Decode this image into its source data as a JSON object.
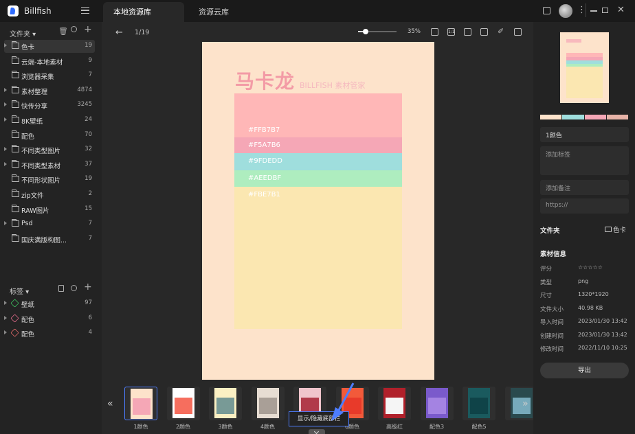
{
  "app": {
    "name": "Billfish"
  },
  "tabs": [
    {
      "label": "本地资源库"
    },
    {
      "label": "资源云库"
    }
  ],
  "sidebar": {
    "folders_title": "文件夹",
    "folders": [
      {
        "label": "色卡",
        "count": "19",
        "selected": true,
        "expandable": true
      },
      {
        "label": "云端-本地素材",
        "count": "9",
        "icon": "cloud-folder-icon"
      },
      {
        "label": "浏览器采集",
        "count": "7",
        "icon": "compass-icon"
      },
      {
        "label": "素材整理",
        "count": "4874",
        "expandable": true
      },
      {
        "label": "快传分享",
        "count": "3245",
        "expandable": true
      },
      {
        "label": "8K壁纸",
        "count": "24",
        "expandable": true
      },
      {
        "label": "配色",
        "count": "70"
      },
      {
        "label": "不同类型图片",
        "count": "32",
        "expandable": true
      },
      {
        "label": "不同类型素材",
        "count": "37",
        "expandable": true
      },
      {
        "label": "不同形状图片",
        "count": "19"
      },
      {
        "label": "zip文件",
        "count": "2"
      },
      {
        "label": "RAW图片",
        "count": "15"
      },
      {
        "label": "Psd",
        "count": "7",
        "expandable": true
      },
      {
        "label": "国庆满版构图...",
        "count": "7"
      }
    ],
    "tags_title": "标签",
    "tags": [
      {
        "label": "壁纸",
        "count": "97",
        "color": "#3fbf5f"
      },
      {
        "label": "配色",
        "count": "6",
        "color": "#e06a8a"
      },
      {
        "label": "配色",
        "count": "4",
        "color": "#e06a6a"
      }
    ]
  },
  "viewer": {
    "page_indicator": "1/19",
    "zoom": "35%",
    "zoom_fraction": 0.2,
    "image": {
      "title": "马卡龙",
      "subtitle": "BILLFISH 素材管家",
      "bands": [
        {
          "label": "#FFB7B7",
          "color": "#ffb7b7"
        },
        {
          "label": "#F5A7B6",
          "color": "#f5a7b6"
        },
        {
          "label": "#9FDEDD",
          "color": "#9fdedd"
        },
        {
          "label": "#AEEDBF",
          "color": "#aeedbf"
        },
        {
          "label": "#FBE7B1",
          "color": "#fbe7b1"
        }
      ]
    },
    "thumbnails": [
      {
        "label": "1颜色",
        "selected": true
      },
      {
        "label": "2颜色"
      },
      {
        "label": "3颜色"
      },
      {
        "label": "4颜色"
      },
      {
        "label": ""
      },
      {
        "label": "6颜色"
      },
      {
        "label": "高级红"
      },
      {
        "label": "配色3"
      },
      {
        "label": "配色5"
      },
      {
        "label": ""
      }
    ],
    "tooltip": "显示/隐藏底部栏"
  },
  "inspector": {
    "palette": [
      "#fde3cb",
      "#9fdedd",
      "#f5a7b6",
      "#e7b3a8"
    ],
    "name_value": "1颜色",
    "tags_placeholder": "添加标签",
    "note_placeholder": "添加备注",
    "url_placeholder": "https://",
    "folder_label": "文件夹",
    "folder_value": "色卡",
    "info_title": "素材信息",
    "rows": [
      {
        "label": "评分",
        "value": "☆☆☆☆☆"
      },
      {
        "label": "类型",
        "value": "png"
      },
      {
        "label": "尺寸",
        "value": "1320*1920"
      },
      {
        "label": "文件大小",
        "value": "40.98 KB"
      },
      {
        "label": "导入时间",
        "value": "2023/01/30 13:42"
      },
      {
        "label": "创建时间",
        "value": "2023/01/30 13:42"
      },
      {
        "label": "修改时间",
        "value": "2022/11/10 10:25"
      }
    ],
    "export_label": "导出"
  }
}
